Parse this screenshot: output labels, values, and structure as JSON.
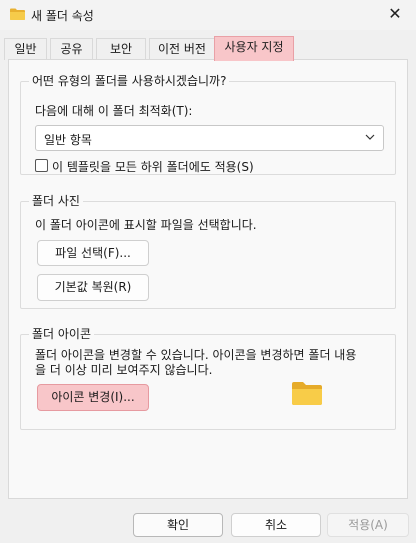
{
  "window": {
    "title": "새 폴더 속성"
  },
  "tabs": [
    {
      "label": "일반"
    },
    {
      "label": "공유"
    },
    {
      "label": "보안"
    },
    {
      "label": "이전 버전"
    },
    {
      "label": "사용자 지정",
      "active": true
    }
  ],
  "optimize_group": {
    "title": "어떤 유형의 폴더를 사용하시겠습니까?",
    "optimize_label": "다음에 대해 이 폴더 최적화(T):",
    "optimize_value": "일반 항목",
    "apply_subfolders_label": "이 템플릿을 모든 하위 폴더에도 적용(S)",
    "apply_subfolders_checked": false
  },
  "picture_group": {
    "title": "폴더 사진",
    "description": "이 폴더 아이콘에 표시할 파일을 선택합니다.",
    "choose_file_label": "파일 선택(F)...",
    "restore_default_label": "기본값 복원(R)"
  },
  "icon_group": {
    "title": "폴더 아이콘",
    "description_line1": "폴더 아이콘을 변경할 수 있습니다. 아이콘을 변경하면 폴더 내용",
    "description_line2": "을 더 이상  미리 보여주지 않습니다.",
    "change_icon_label": "아이콘 변경(I)..."
  },
  "footer": {
    "ok_label": "확인",
    "cancel_label": "취소",
    "apply_label": "적용(A)"
  },
  "colors": {
    "highlight": "#f8c6c9",
    "folder_yellow": "#f4c542"
  }
}
